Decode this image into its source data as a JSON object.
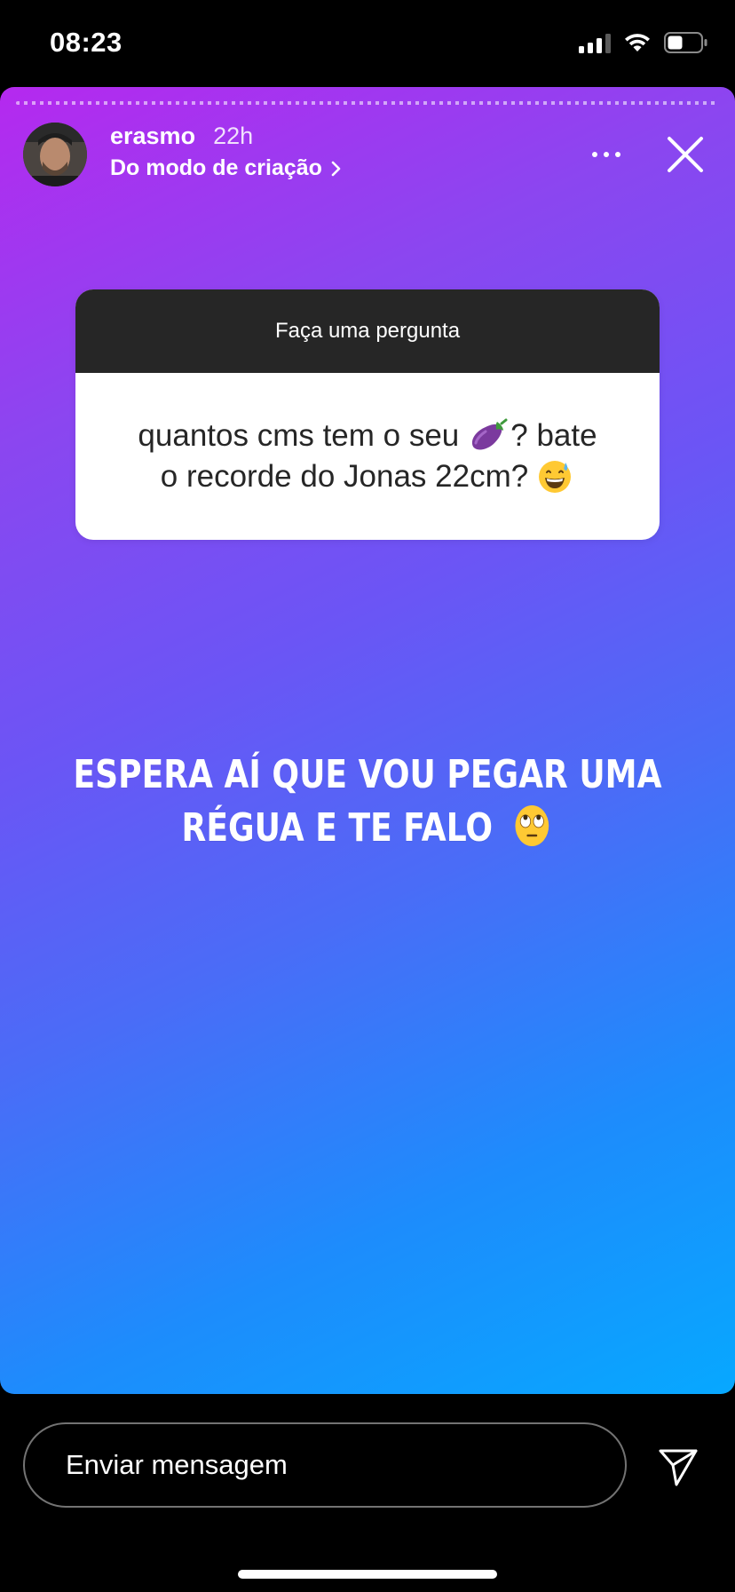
{
  "status_bar": {
    "time": "08:23"
  },
  "story": {
    "username": "erasmo",
    "time_ago": "22h",
    "subtitle": "Do modo de criação",
    "question_sticker": {
      "header": "Faça uma pergunta",
      "line1_before": "quantos cms tem o seu",
      "line1_emoji": "eggplant-emoji",
      "line1_after": "? bate",
      "line2": "o recorde do Jonas 22cm?",
      "line2_emoji": "grinning-sweat-emoji"
    },
    "answer": {
      "line1": "ESPERA AÍ QUE VOU PEGAR UMA",
      "line2": "RÉGUA E TE FALO",
      "emoji": "rolling-eyes-emoji"
    },
    "colors": {
      "gradient_start": "#b529ef",
      "gradient_mid": "#6b55f5",
      "gradient_end": "#07a8ff"
    }
  },
  "bottom_bar": {
    "message_placeholder": "Enviar mensagem"
  }
}
